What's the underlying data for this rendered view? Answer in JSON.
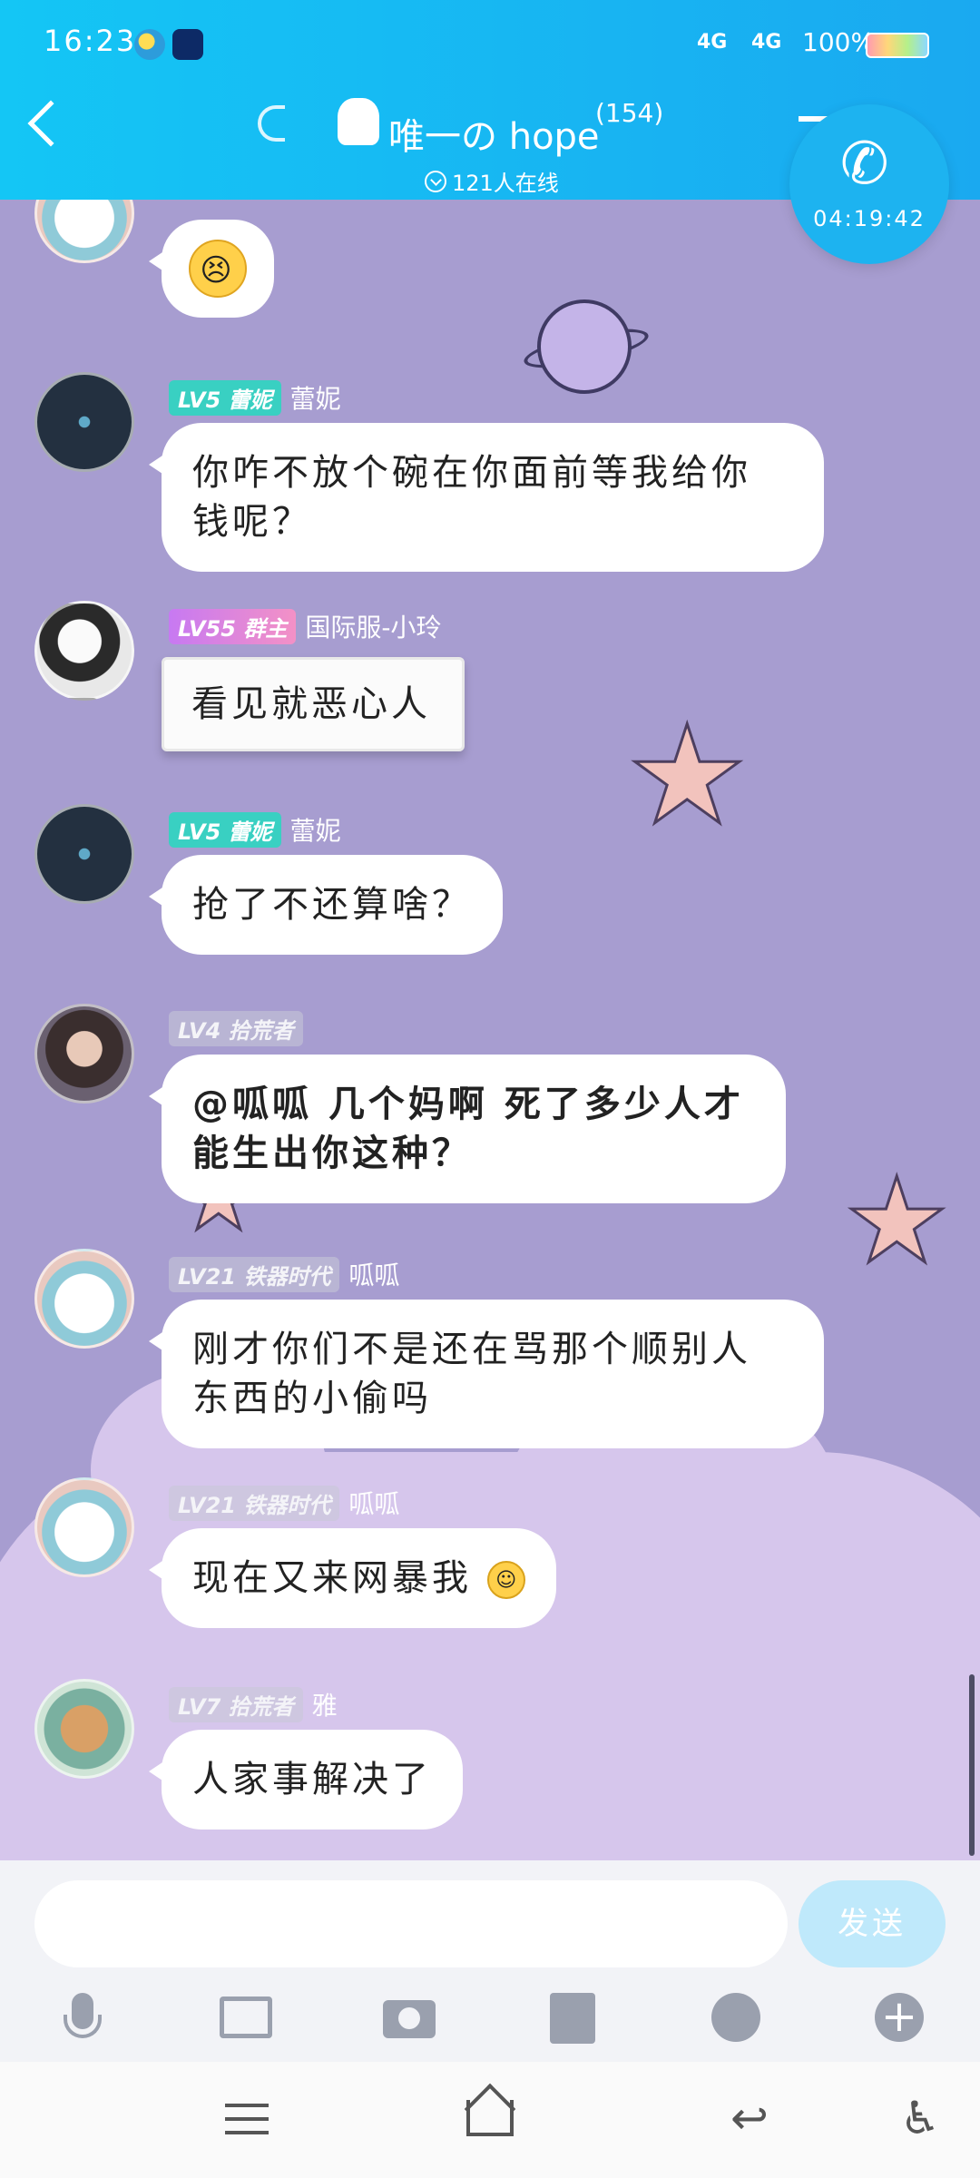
{
  "status_bar": {
    "time": "16:23",
    "network1": "4G",
    "network2": "4G",
    "battery": "100%"
  },
  "header": {
    "group_name": "唯一の hope",
    "member_count": "(154)",
    "online_text": "121人在线"
  },
  "call": {
    "timer": "04:19:42"
  },
  "messages": [
    {
      "badge": "",
      "name": "",
      "text": "😣",
      "emoji_only": true
    },
    {
      "badge": "LV5 蕾妮",
      "name": "蕾妮",
      "line1": "你咋不放个碗在你面前等我给你",
      "line2": "钱呢？"
    },
    {
      "badge": "LV55 群主",
      "name": "国际服-小玲",
      "text": "看见就恶心人"
    },
    {
      "badge": "LV5 蕾妮",
      "name": "蕾妮",
      "text": "抢了不还算啥？"
    },
    {
      "badge": "LV4 拾荒者",
      "name": "",
      "line1": "@呱呱 几个妈啊 死了多少人才",
      "line2": "能生出你这种？"
    },
    {
      "badge": "LV21 铁器时代",
      "name": "呱呱",
      "line1": "刚才你们不是还在骂那个顺别人",
      "line2": "东西的小偷吗"
    },
    {
      "badge": "LV21 铁器时代",
      "name": "呱呱",
      "text": "现在又来网暴我"
    },
    {
      "badge": "LV7 拾荒者",
      "name": "雅",
      "text": "人家事解决了"
    }
  ],
  "input": {
    "placeholder": "",
    "send_label": "发送"
  },
  "icons": {
    "mic": "mic-icon",
    "image": "image-icon",
    "camera": "camera-icon",
    "red_packet": "red-packet-icon",
    "emoji": "emoji-icon",
    "plus": "plus-icon"
  },
  "colors": {
    "header_accent": "#14c6f5",
    "chat_background": "#a79dd0",
    "send_button": "#bfe9fb"
  }
}
